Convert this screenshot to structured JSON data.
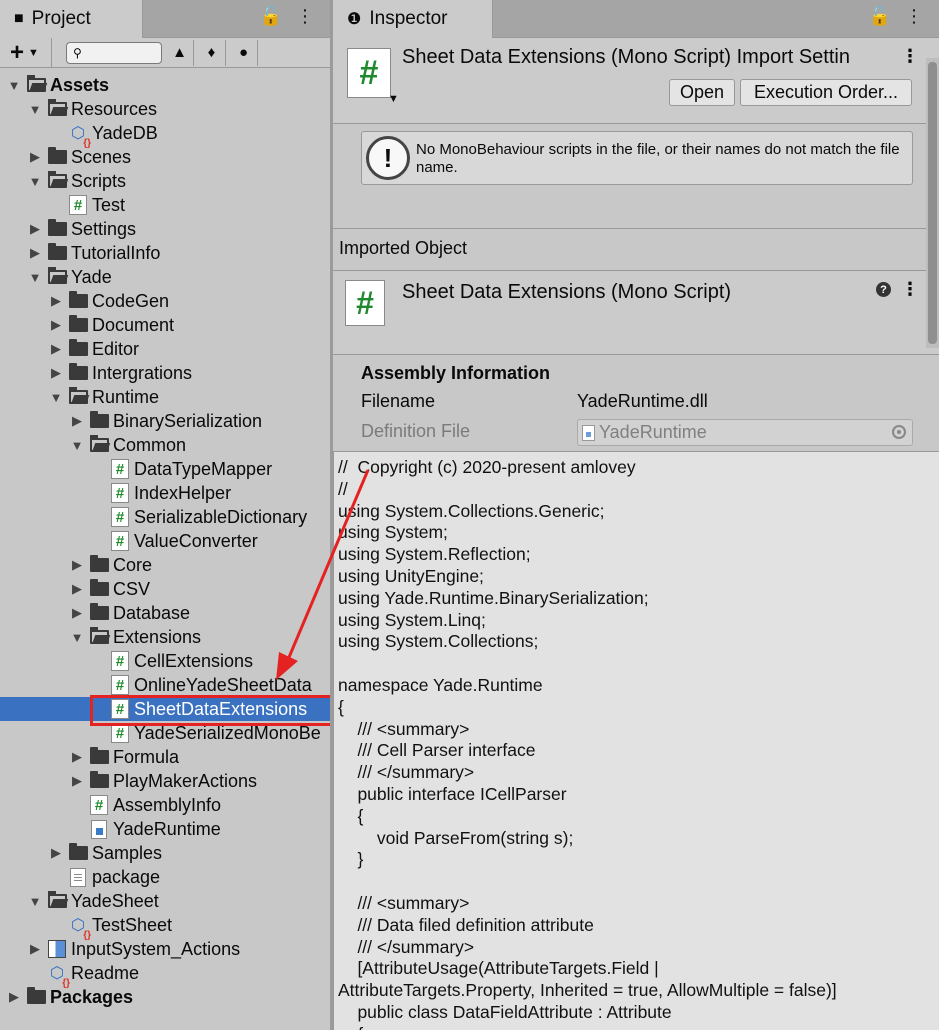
{
  "project": {
    "tab_label": "Project",
    "tree": [
      {
        "label": "Assets",
        "depth": 0,
        "arrow": "down",
        "icon": "folder-open",
        "bold": true
      },
      {
        "label": "Resources",
        "depth": 1,
        "arrow": "down",
        "icon": "folder-open"
      },
      {
        "label": "YadeDB",
        "depth": 2,
        "arrow": "",
        "icon": "cube"
      },
      {
        "label": "Scenes",
        "depth": 1,
        "arrow": "right",
        "icon": "folder"
      },
      {
        "label": "Scripts",
        "depth": 1,
        "arrow": "down",
        "icon": "folder-open"
      },
      {
        "label": "Test",
        "depth": 2,
        "arrow": "",
        "icon": "script"
      },
      {
        "label": "Settings",
        "depth": 1,
        "arrow": "right",
        "icon": "folder"
      },
      {
        "label": "TutorialInfo",
        "depth": 1,
        "arrow": "right",
        "icon": "folder"
      },
      {
        "label": "Yade",
        "depth": 1,
        "arrow": "down",
        "icon": "folder-open"
      },
      {
        "label": "CodeGen",
        "depth": 2,
        "arrow": "right",
        "icon": "folder"
      },
      {
        "label": "Document",
        "depth": 2,
        "arrow": "right",
        "icon": "folder"
      },
      {
        "label": "Editor",
        "depth": 2,
        "arrow": "right",
        "icon": "folder"
      },
      {
        "label": "Intergrations",
        "depth": 2,
        "arrow": "right",
        "icon": "folder"
      },
      {
        "label": "Runtime",
        "depth": 2,
        "arrow": "down",
        "icon": "folder-open"
      },
      {
        "label": "BinarySerialization",
        "depth": 3,
        "arrow": "right",
        "icon": "folder"
      },
      {
        "label": "Common",
        "depth": 3,
        "arrow": "down",
        "icon": "folder-open"
      },
      {
        "label": "DataTypeMapper",
        "depth": 4,
        "arrow": "",
        "icon": "script"
      },
      {
        "label": "IndexHelper",
        "depth": 4,
        "arrow": "",
        "icon": "script"
      },
      {
        "label": "SerializableDictionary",
        "depth": 4,
        "arrow": "",
        "icon": "script"
      },
      {
        "label": "ValueConverter",
        "depth": 4,
        "arrow": "",
        "icon": "script"
      },
      {
        "label": "Core",
        "depth": 3,
        "arrow": "right",
        "icon": "folder"
      },
      {
        "label": "CSV",
        "depth": 3,
        "arrow": "right",
        "icon": "folder"
      },
      {
        "label": "Database",
        "depth": 3,
        "arrow": "right",
        "icon": "folder"
      },
      {
        "label": "Extensions",
        "depth": 3,
        "arrow": "down",
        "icon": "folder-open"
      },
      {
        "label": "CellExtensions",
        "depth": 4,
        "arrow": "",
        "icon": "script"
      },
      {
        "label": "OnlineYadeSheetData",
        "depth": 4,
        "arrow": "",
        "icon": "script"
      },
      {
        "label": "SheetDataExtensions",
        "depth": 4,
        "arrow": "",
        "icon": "script",
        "selected": true
      },
      {
        "label": "YadeSerializedMonoBe",
        "depth": 4,
        "arrow": "",
        "icon": "script"
      },
      {
        "label": "Formula",
        "depth": 3,
        "arrow": "right",
        "icon": "folder"
      },
      {
        "label": "PlayMakerActions",
        "depth": 3,
        "arrow": "right",
        "icon": "folder"
      },
      {
        "label": "AssemblyInfo",
        "depth": 3,
        "arrow": "",
        "icon": "script"
      },
      {
        "label": "YadeRuntime",
        "depth": 3,
        "arrow": "",
        "icon": "dll"
      },
      {
        "label": "Samples",
        "depth": 2,
        "arrow": "right",
        "icon": "folder"
      },
      {
        "label": "package",
        "depth": 2,
        "arrow": "",
        "icon": "doc"
      },
      {
        "label": "YadeSheet",
        "depth": 1,
        "arrow": "down",
        "icon": "folder-open"
      },
      {
        "label": "TestSheet",
        "depth": 2,
        "arrow": "",
        "icon": "cube"
      },
      {
        "label": "InputSystem_Actions",
        "depth": 1,
        "arrow": "right",
        "icon": "input"
      },
      {
        "label": "Readme",
        "depth": 1,
        "arrow": "",
        "icon": "cube"
      },
      {
        "label": "Packages",
        "depth": 0,
        "arrow": "right",
        "icon": "folder",
        "bold": true
      }
    ]
  },
  "inspector": {
    "tab_label": "Inspector",
    "title": "Sheet Data Extensions (Mono Script) Import Settin",
    "open_label": "Open",
    "execution_order_label": "Execution Order...",
    "help_message": "No MonoBehaviour scripts in the file, or their names do not match the file name.",
    "imported_object_label": "Imported Object",
    "object_title": "Sheet Data Extensions (Mono Script)",
    "assembly": {
      "heading": "Assembly Information",
      "filename_key": "Filename",
      "filename_value": "YadeRuntime.dll",
      "definition_key": "Definition File",
      "definition_value": "YadeRuntime"
    },
    "code": "//  Copyright (c) 2020-present amlovey\n//\nusing System.Collections.Generic;\nusing System;\nusing System.Reflection;\nusing UnityEngine;\nusing Yade.Runtime.BinarySerialization;\nusing System.Linq;\nusing System.Collections;\n\nnamespace Yade.Runtime\n{\n    /// <summary>\n    /// Cell Parser interface\n    /// </summary>\n    public interface ICellParser\n    {\n        void ParseFrom(string s);\n    }\n\n    /// <summary>\n    /// Data filed definition attribute\n    /// </summary>\n    [AttributeUsage(AttributeTargets.Field |\nAttributeTargets.Property, Inherited = true, AllowMultiple = false)]\n    public class DataFieldAttribute : Attribute\n    {"
  },
  "colors": {
    "selection": "#3a71c1",
    "highlight_box": "#e52222",
    "script_hash": "#1f8a2d"
  }
}
